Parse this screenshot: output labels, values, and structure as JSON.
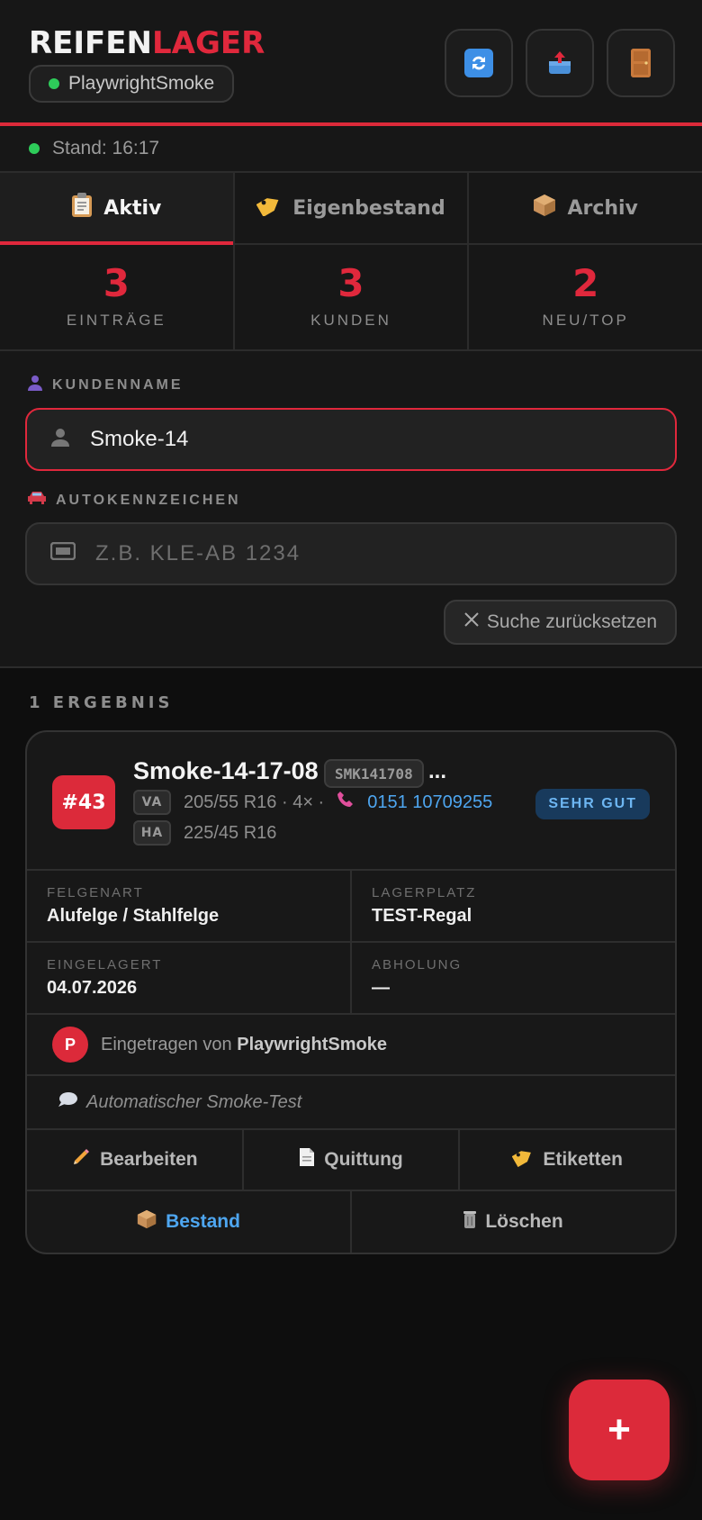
{
  "header": {
    "brand_part1": "REIFEN",
    "brand_part2": "LAGER",
    "user": "PlaywrightSmoke",
    "buttons": [
      "refresh",
      "export",
      "logout"
    ]
  },
  "status": {
    "text": "Stand: 16:17"
  },
  "tabs": [
    {
      "label": "Aktiv",
      "icon": "clipboard-icon",
      "active": true
    },
    {
      "label": "Eigenbestand",
      "icon": "tag-icon",
      "active": false
    },
    {
      "label": "Archiv",
      "icon": "box-icon",
      "active": false
    }
  ],
  "stats": [
    {
      "value": "3",
      "label": "EINTRÄGE"
    },
    {
      "value": "3",
      "label": "KUNDEN"
    },
    {
      "value": "2",
      "label": "NEU/TOP"
    }
  ],
  "search": {
    "customer_label": "KUNDENNAME",
    "customer_value": "Smoke-14",
    "plate_label": "AUTOKENNZEICHEN",
    "plate_placeholder": "Z.B. KLE-AB 1234",
    "reset_label": "Suche zurücksetzen"
  },
  "results": {
    "count_label": "1 ERGEBNIS",
    "card": {
      "number": "#43",
      "name": "Smoke-14-17-08",
      "code": "SMK141708",
      "code_ellipsis": "...",
      "front_tag": "VA",
      "front_size": "205/55 R16 · 4× ·",
      "rear_tag": "HA",
      "rear_size": "225/45 R16",
      "phone": "0151 10709255",
      "condition": "SEHR GUT",
      "rim_label": "FELGENART",
      "rim_value": "Alufelge / Stahlfelge",
      "storage_label": "LAGERPLATZ",
      "storage_value": "TEST-Regal",
      "stored_label": "EINGELAGERT",
      "stored_value": "04.07.2026",
      "pickup_label": "ABHOLUNG",
      "pickup_value": "—",
      "author_initial": "P",
      "author_prefix": "Eingetragen von",
      "author_name": "PlaywrightSmoke",
      "note": "Automatischer Smoke-Test",
      "actions": {
        "edit": "Bearbeiten",
        "receipt": "Quittung",
        "labels": "Etiketten",
        "stock": "Bestand",
        "delete": "Löschen"
      }
    }
  },
  "fab": {
    "label": "+"
  },
  "colors": {
    "accent": "#dc2a3a",
    "link": "#4ea6f0",
    "online": "#2ecc5a"
  }
}
